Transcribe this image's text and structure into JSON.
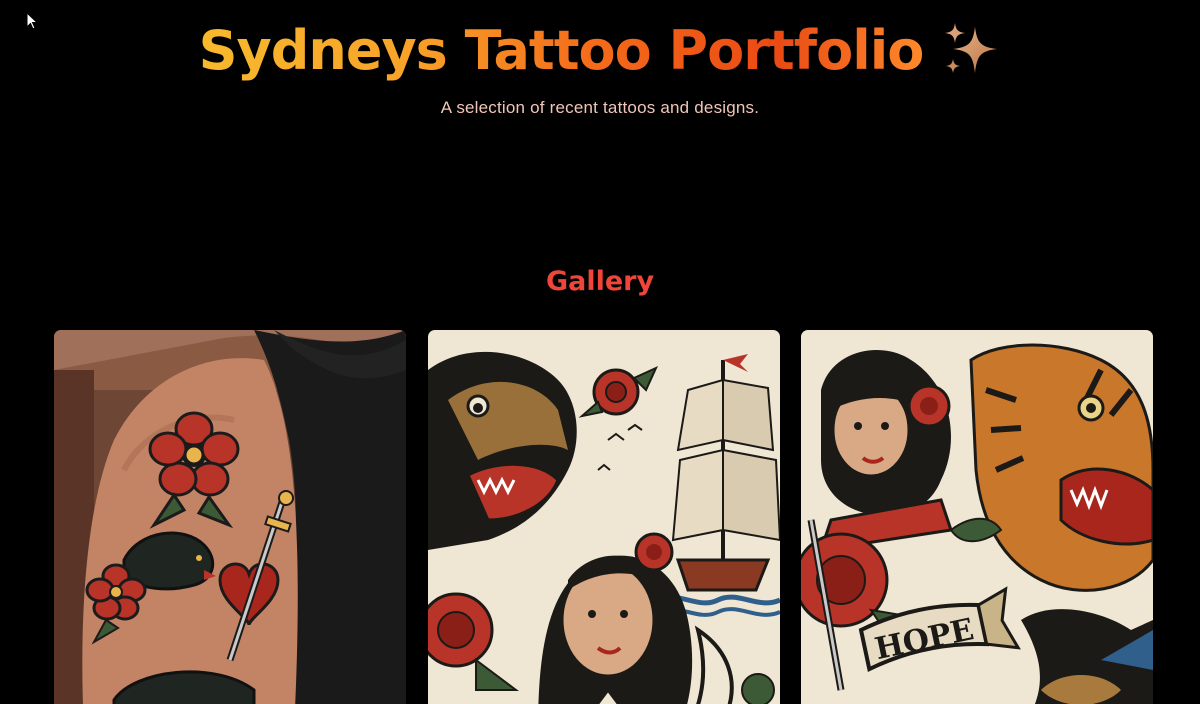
{
  "header": {
    "title": "Sydneys Tattoo Portfolio",
    "subtitle": "A selection of recent tattoos and designs.",
    "title_icon": "sparkles-icon"
  },
  "gallery": {
    "heading": "Gallery",
    "items": [
      {
        "description": "Traditional tattoo sleeve on upper arm: red flowers, black panther, heart with dagger"
      },
      {
        "description": "Traditional flash sheet: snarling dog, roses, sailing ship, woman portrait, swallow"
      },
      {
        "description": "Traditional flash sheet: woman with rose, tiger head, rose with dagger, HOPE banner, swallow"
      }
    ],
    "banner_text": "HOPE"
  },
  "colors": {
    "background": "#000000",
    "title_gradient_start": "#f8b92c",
    "title_gradient_end": "#ea4a14",
    "subtitle": "#f1c6b8",
    "gallery_heading": "#f0463a"
  }
}
